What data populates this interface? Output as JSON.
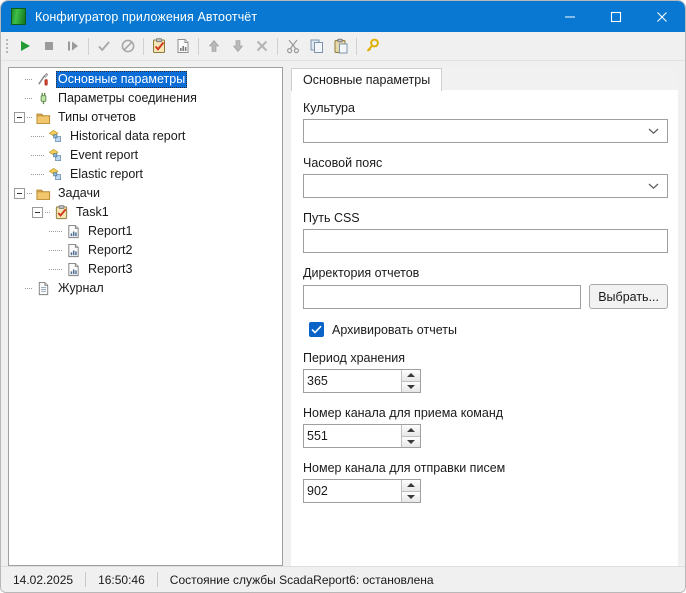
{
  "window": {
    "title": "Конфигуратор приложения Автоотчёт",
    "icon": "app-green-icon",
    "accent_color": "#0878d2",
    "selection_color": "#0a6cd6"
  },
  "caption_buttons": [
    {
      "name": "minimize-button",
      "glyph": "minimize-icon"
    },
    {
      "name": "maximize-button",
      "glyph": "maximize-icon"
    },
    {
      "name": "close-button",
      "glyph": "close-icon"
    }
  ],
  "toolbar": {
    "buttons": [
      {
        "name": "start-button",
        "icon": "play-icon",
        "enabled": true
      },
      {
        "name": "stop-button",
        "icon": "stop-icon",
        "enabled": false
      },
      {
        "name": "step-button",
        "icon": "step-icon",
        "enabled": false
      },
      {
        "name": "apply-button",
        "icon": "check-icon",
        "enabled": false
      },
      {
        "name": "cancel-button",
        "icon": "no-entry-icon",
        "enabled": false
      },
      {
        "name": "add-task-button",
        "icon": "clipboard-check-icon",
        "enabled": true
      },
      {
        "name": "add-report-button",
        "icon": "report-document-icon",
        "enabled": true
      },
      {
        "name": "move-up-button",
        "icon": "arrow-up-icon",
        "enabled": true
      },
      {
        "name": "move-down-button",
        "icon": "arrow-down-icon",
        "enabled": true
      },
      {
        "name": "delete-button",
        "icon": "x-icon",
        "enabled": false
      },
      {
        "name": "cut-button",
        "icon": "scissors-icon",
        "enabled": true
      },
      {
        "name": "copy-button",
        "icon": "copy-icon",
        "enabled": true
      },
      {
        "name": "paste-button",
        "icon": "paste-icon",
        "enabled": true
      },
      {
        "name": "register-button",
        "icon": "key-icon",
        "enabled": true
      }
    ]
  },
  "tree": {
    "nodes": [
      {
        "label": "Основные параметры",
        "icon": "tools-icon",
        "depth": 1,
        "selected": true,
        "expander": "none"
      },
      {
        "label": "Параметры соединения",
        "icon": "plug-icon",
        "depth": 1,
        "selected": false,
        "expander": "none"
      },
      {
        "label": "Типы отчетов",
        "icon": "folder-icon",
        "depth": 0,
        "selected": false,
        "expander": "expanded"
      },
      {
        "label": "Historical data report",
        "icon": "report-type-icon",
        "depth": 2,
        "selected": false,
        "expander": "none"
      },
      {
        "label": "Event report",
        "icon": "report-type-icon",
        "depth": 2,
        "selected": false,
        "expander": "none"
      },
      {
        "label": "Elastic report",
        "icon": "report-type-icon",
        "depth": 2,
        "selected": false,
        "expander": "none"
      },
      {
        "label": "Задачи",
        "icon": "folder-icon",
        "depth": 0,
        "selected": false,
        "expander": "expanded"
      },
      {
        "label": "Task1",
        "icon": "task-icon",
        "depth": 1,
        "selected": false,
        "expander": "expanded"
      },
      {
        "label": "Report1",
        "icon": "report-doc-icon",
        "depth": 3,
        "selected": false,
        "expander": "none"
      },
      {
        "label": "Report2",
        "icon": "report-doc-icon",
        "depth": 3,
        "selected": false,
        "expander": "none"
      },
      {
        "label": "Report3",
        "icon": "report-doc-icon",
        "depth": 3,
        "selected": false,
        "expander": "none"
      },
      {
        "label": "Журнал",
        "icon": "log-document-icon",
        "depth": 1,
        "selected": false,
        "expander": "none"
      }
    ]
  },
  "main": {
    "tabs": [
      {
        "label": "Основные параметры",
        "active": true
      }
    ],
    "fields": {
      "culture": {
        "label": "Культура",
        "value": "",
        "type": "combobox"
      },
      "timezone": {
        "label": "Часовой пояс",
        "value": "",
        "type": "combobox"
      },
      "css_path": {
        "label": "Путь CSS",
        "value": "",
        "placeholder": "",
        "type": "textbox"
      },
      "reports_dir": {
        "label": "Директория отчетов",
        "value": "",
        "placeholder": "",
        "type": "textbox",
        "browse_label": "Выбрать..."
      },
      "archive_reports": {
        "label": "Архивировать отчеты",
        "checked": true,
        "type": "checkbox"
      },
      "retention_period": {
        "label": "Период хранения",
        "value": "365",
        "type": "spinner"
      },
      "command_channel": {
        "label": "Номер канала для приема команд",
        "value": "551",
        "type": "spinner"
      },
      "mail_channel": {
        "label": "Номер канала для отправки писем",
        "value": "902",
        "type": "spinner"
      }
    }
  },
  "statusbar": {
    "date": "14.02.2025",
    "time": "16:50:46",
    "service_status": "Состояние службы ScadaReport6: остановлена"
  }
}
